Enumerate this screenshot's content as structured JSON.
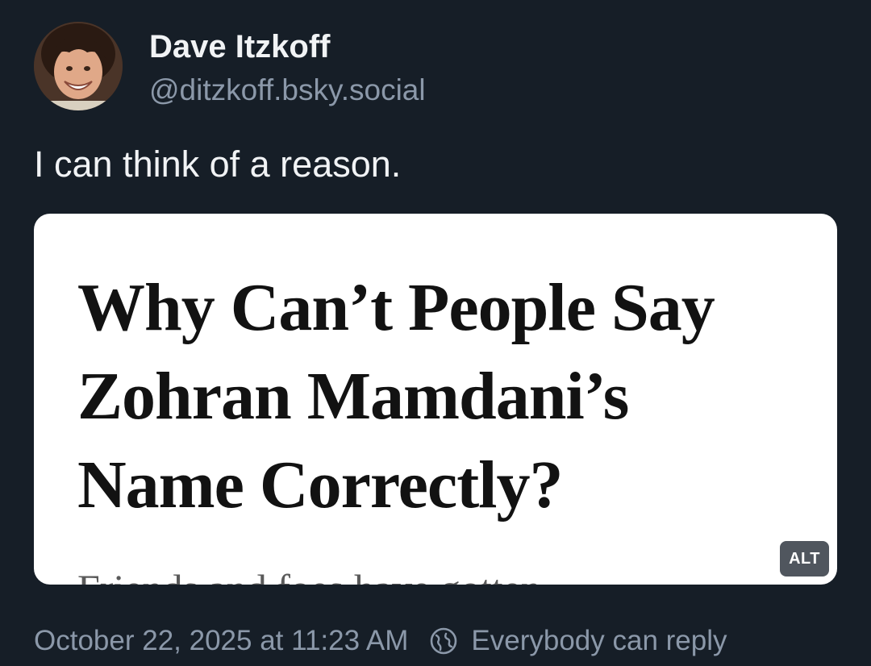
{
  "author": {
    "display_name": "Dave Itzkoff",
    "handle": "@ditzkoff.bsky.social",
    "avatar_icon": "child-portrait-avatar"
  },
  "post": {
    "text": "I can think of a reason."
  },
  "media": {
    "headline_lines": [
      "Why Can’t People Say",
      "Zohran Mamdani’s",
      "Name Correctly?"
    ],
    "subhead_partial": "Friends and foes have gotten",
    "alt_label": "ALT"
  },
  "footer": {
    "timestamp": "October 22, 2025 at 11:23 AM",
    "reply_icon": "globe-icon",
    "reply_setting": "Everybody can reply"
  },
  "colors": {
    "background": "#161e27",
    "text_primary": "#f1f3f5",
    "text_secondary": "#8b98a9",
    "card_background": "#ffffff",
    "alt_badge": "#50565e"
  }
}
